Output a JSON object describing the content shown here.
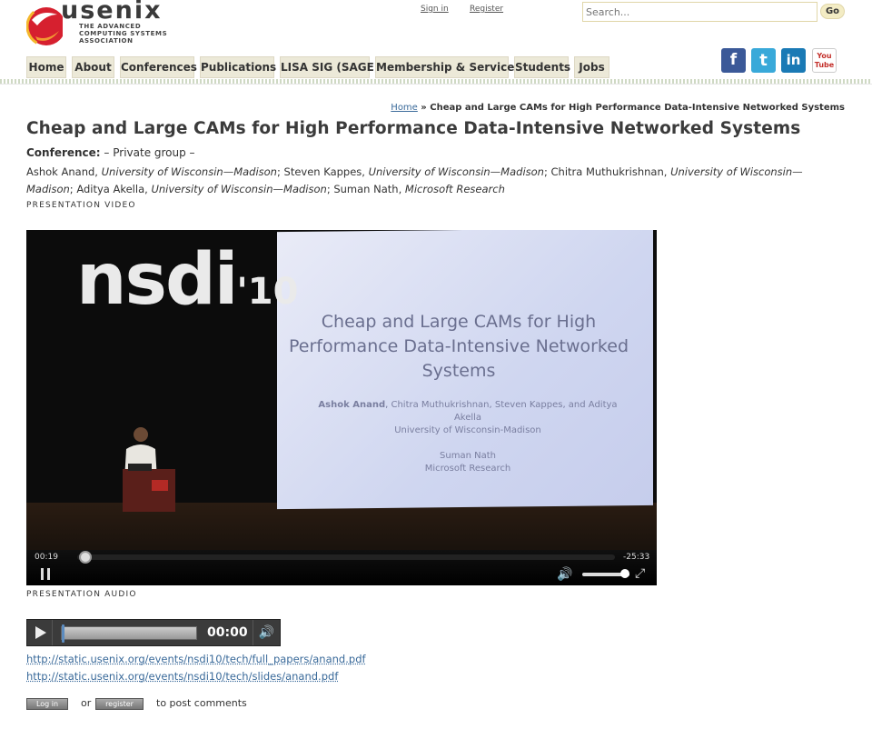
{
  "header": {
    "logo_text": "usenix",
    "logo_tagline": "THE ADVANCED COMPUTING SYSTEMS ASSOCIATION",
    "sign_in": "Sign in",
    "register": "Register",
    "search_placeholder": "Search...",
    "go": "Go"
  },
  "nav": [
    {
      "label": "Home"
    },
    {
      "label": "About"
    },
    {
      "label": "Conferences"
    },
    {
      "label": "Publications"
    },
    {
      "label": "LISA SIG (SAGE)"
    },
    {
      "label": "Membership & Services"
    },
    {
      "label": "Students"
    },
    {
      "label": "Jobs"
    }
  ],
  "social": [
    {
      "icon": "facebook-icon",
      "glyph": "f",
      "color": "#3b5998"
    },
    {
      "icon": "twitter-icon",
      "glyph": "t",
      "color": "#39a9d9"
    },
    {
      "icon": "linkedin-icon",
      "glyph": "in",
      "color": "#1a7ab5"
    },
    {
      "icon": "youtube-icon",
      "glyph": "You Tube",
      "color": "#c4302b"
    }
  ],
  "breadcrumb": {
    "home": "Home",
    "separator": " » ",
    "current": "Cheap and Large CAMs for High Performance Data-Intensive Networked Systems"
  },
  "title": "Cheap and Large CAMs for High Performance Data-Intensive Networked Systems",
  "conference": {
    "label": "Conference:",
    "value": " – Private group –"
  },
  "authors": [
    {
      "name": "Ashok Anand, ",
      "affiliation": "University of Wisconsin—Madison",
      "sep": "; "
    },
    {
      "name": "Steven Kappes, ",
      "affiliation": "University of Wisconsin—Madison",
      "sep": "; "
    },
    {
      "name": "Chitra Muthukrishnan, ",
      "affiliation": "University of Wisconsin—Madison",
      "sep": "; "
    },
    {
      "name": "Aditya Akella, ",
      "affiliation": "University of Wisconsin—Madison",
      "sep": "; "
    },
    {
      "name": "Suman Nath, ",
      "affiliation": "Microsoft Research",
      "sep": ""
    }
  ],
  "video": {
    "section_label": "Presentation Video",
    "logo": "nsdi",
    "logo_year": "'10",
    "slide_title": "Cheap and Large CAMs for High Performance Data-Intensive Networked Systems",
    "slide_authors_lead": "Ashok Anand",
    "slide_authors_rest": ", Chitra Muthukrishnan, Steven Kappes, and Aditya Akella",
    "slide_aff1": "University of Wisconsin-Madison",
    "slide_author2": "Suman Nath",
    "slide_aff2": "Microsoft Research",
    "elapsed": "00:19",
    "remaining": "-25:33",
    "progress": 0.012,
    "volume": 0.9
  },
  "audio": {
    "section_label": "Presentation Audio",
    "time": "00:00",
    "progress": 0.0
  },
  "links": [
    "http://static.usenix.org/events/nsdi10/tech/full_papers/anand.pdf",
    "http://static.usenix.org/events/nsdi10/tech/slides/anand.pdf"
  ],
  "comments": {
    "login": "Log in",
    "or": "or",
    "register": "register",
    "suffix": "to post comments"
  }
}
